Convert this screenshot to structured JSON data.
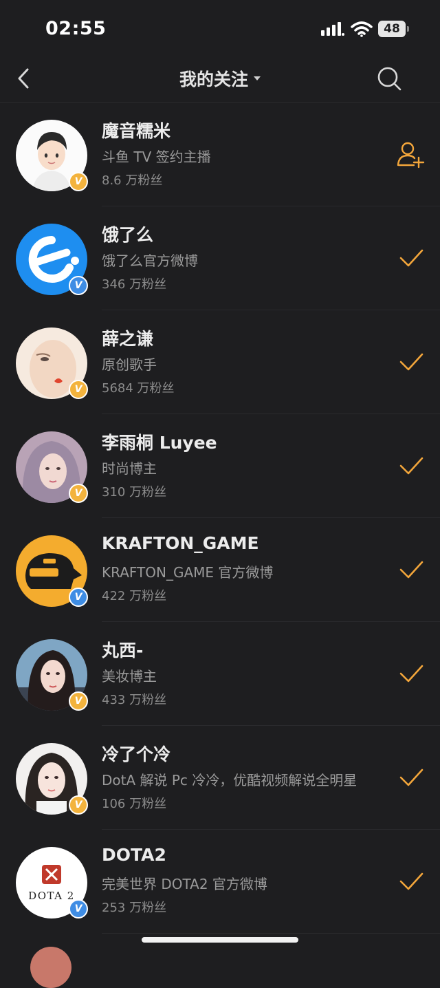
{
  "status_bar": {
    "time": "02:55",
    "battery": "48"
  },
  "header": {
    "title": "我的关注"
  },
  "colors": {
    "accent": "#f3a63b",
    "background": "#1e1e20",
    "verified_gold": "#f3b33d",
    "verified_blue": "#3f8de4"
  },
  "follow_list": [
    {
      "name": "魔音糯米",
      "description": "斗鱼 TV 签约主播",
      "fans": "8.6 万粉丝",
      "verified": "gold",
      "action_icon": "add-follow-icon"
    },
    {
      "name": "饿了么",
      "description": "饿了么官方微博",
      "fans": "346 万粉丝",
      "verified": "blue",
      "action_icon": "followed-check-icon"
    },
    {
      "name": "薛之谦",
      "description": "原创歌手",
      "fans": "5684 万粉丝",
      "verified": "gold",
      "action_icon": "followed-check-icon"
    },
    {
      "name": "李雨桐 Luyee",
      "description": "时尚博主",
      "fans": "310 万粉丝",
      "verified": "gold",
      "action_icon": "followed-check-icon"
    },
    {
      "name": "KRAFTON_GAME",
      "description": "KRAFTON_GAME 官方微博",
      "fans": "422 万粉丝",
      "verified": "blue",
      "action_icon": "followed-check-icon"
    },
    {
      "name": "丸西-",
      "description": "美妆博主",
      "fans": "433 万粉丝",
      "verified": "gold",
      "action_icon": "followed-check-icon"
    },
    {
      "name": "冷了个冷",
      "description": "DotA 解说 Pc 冷冷，优酷视频解说全明星",
      "fans": "106 万粉丝",
      "verified": "gold",
      "action_icon": "followed-check-icon"
    },
    {
      "name": "DOTA2",
      "description": "完美世界 DOTA2 官方微博",
      "fans": "253 万粉丝",
      "verified": "blue",
      "action_icon": "followed-check-icon"
    }
  ],
  "logos": {
    "dota2_wordmark": "DOTA 2"
  },
  "badge_glyph": "V"
}
